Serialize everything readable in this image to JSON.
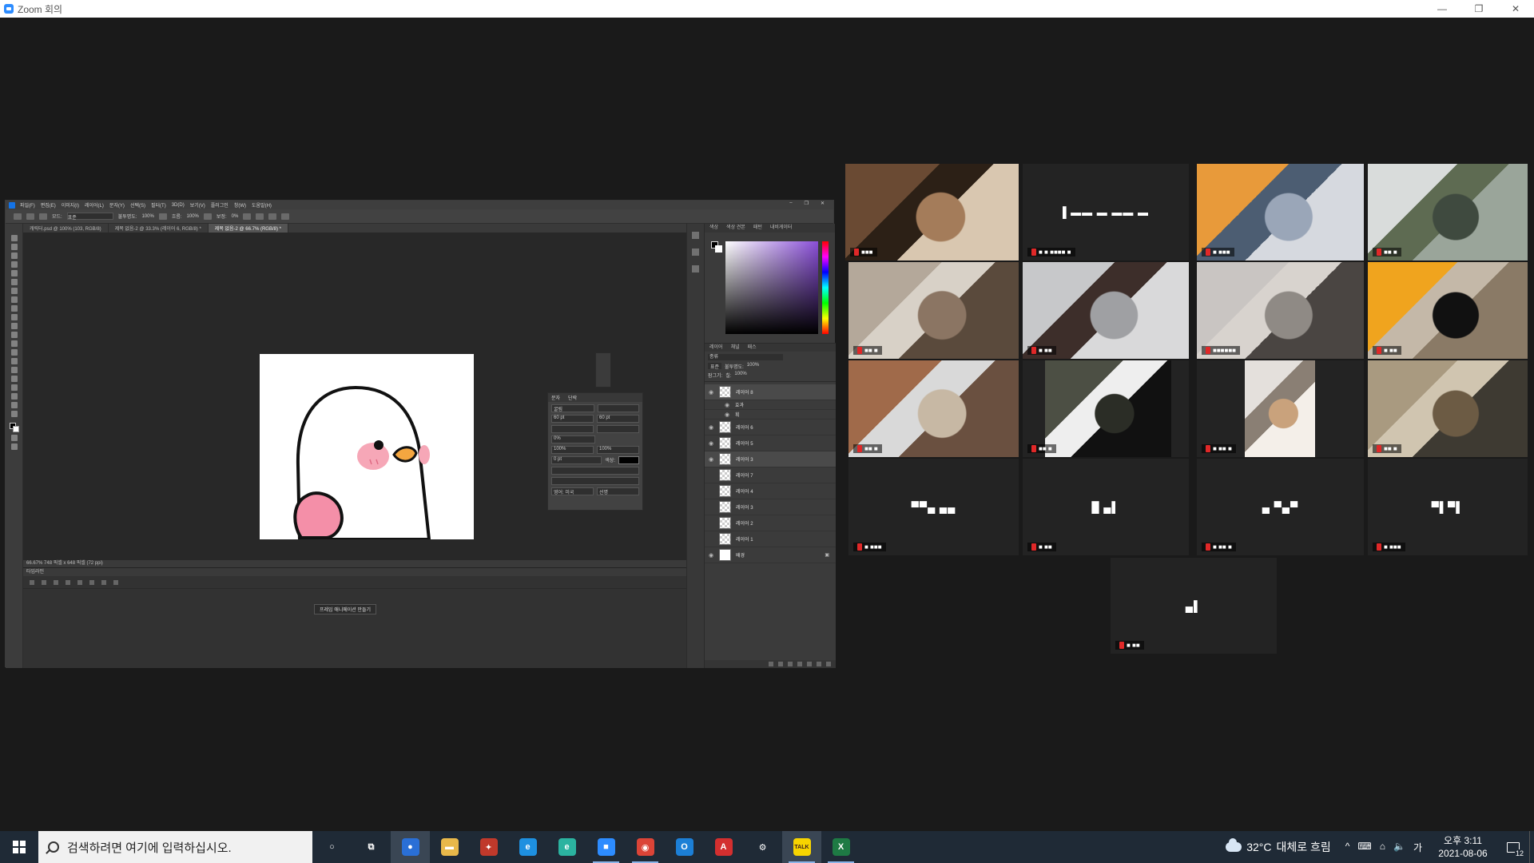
{
  "window": {
    "title": "Zoom 회의",
    "minimize": "—",
    "restore": "❐",
    "close": "✕"
  },
  "photoshop": {
    "menu": [
      "파일(F)",
      "편집(E)",
      "이미지(I)",
      "레이어(L)",
      "문자(Y)",
      "선택(S)",
      "필터(T)",
      "3D(D)",
      "보기(V)",
      "플러그인",
      "창(W)",
      "도움말(H)"
    ],
    "options": {
      "mode_label": "모드:",
      "mode_value": "표준",
      "opacity_label": "불투명도:",
      "opacity_value": "100%",
      "flow_label": "흐름:",
      "flow_value": "100%",
      "smooth_label": "보정:",
      "smooth_value": "0%"
    },
    "tabs": [
      "캐릭터.psd @ 100% (103, RGB/8)",
      "제목 없음-2 @ 33.3% (레이어 6, RGB/8) *",
      "제목 없음-2 @ 66.7% (RGB/8) *"
    ],
    "status": "66.67%    748 픽셀 x 648 픽셀 (72 ppi)",
    "char_panel": {
      "tab1": "문자",
      "tab2": "단락",
      "font": "굴림",
      "size": "60 pt",
      "leading": "60 pt",
      "scale_v": "100%",
      "scale_h": "100%",
      "tracking": "0%",
      "baseline": "0 pt",
      "color_label": "색상:",
      "lang": "영어: 미국",
      "aa": "선명"
    },
    "timeline": {
      "title": "타임라인",
      "button": "프레임 애니메이션 만들기"
    },
    "right": {
      "color_tabs": [
        "색상",
        "색상 견본",
        "패턴",
        "내비게이터"
      ],
      "layer_tabs": [
        "레이어",
        "채널",
        "패스"
      ],
      "kind_label": "종류",
      "blend": "표준",
      "opacity_label": "불투명도:",
      "opacity": "100%",
      "lock_label": "잠그기:",
      "fill_label": "칠:",
      "fill": "100%",
      "layers": [
        {
          "name": "레이어 8",
          "visible": true,
          "selected": true
        },
        {
          "name": "효과",
          "visible": true,
          "sub": true
        },
        {
          "name": "획",
          "visible": true,
          "sub": true
        },
        {
          "name": "레이어 6",
          "visible": true
        },
        {
          "name": "레이어 5",
          "visible": true
        },
        {
          "name": "레이어 3",
          "visible": true
        },
        {
          "name": "레이어 7",
          "visible": false
        },
        {
          "name": "레이어 4",
          "visible": false
        },
        {
          "name": "레이어 3",
          "visible": false
        },
        {
          "name": "레이어 2",
          "visible": false
        },
        {
          "name": "레이어 1",
          "visible": false
        },
        {
          "name": "배경",
          "visible": true,
          "background": true
        }
      ]
    }
  },
  "gallery": [
    {
      "id": "p1",
      "active": true,
      "kind": "video",
      "colors": [
        "#6a4a33",
        "#a47c5a",
        "#2c2016",
        "#d9c7b0"
      ],
      "name_tag": "■■■"
    },
    {
      "id": "p2",
      "kind": "name",
      "label": "▌▬▬ ▬ ▬▬ ▬",
      "name_tag": "■ ■ ■■■■ ■"
    },
    {
      "id": "p3",
      "kind": "video",
      "colors": [
        "#e89a3a",
        "#9aa6b8",
        "#4c5d72",
        "#d6d9df"
      ],
      "name_tag": "■ ■■■"
    },
    {
      "id": "p4",
      "kind": "video",
      "colors": [
        "#d9dcdb",
        "#3f4a3f",
        "#5e6b52",
        "#9aa59a"
      ],
      "name_tag": "■■ ■"
    },
    {
      "id": "p5",
      "kind": "video",
      "colors": [
        "#b4a89a",
        "#8b7563",
        "#d8d1c7",
        "#5a4a3c"
      ],
      "name_tag": "■■ ■"
    },
    {
      "id": "p6",
      "kind": "video",
      "colors": [
        "#c7c8ca",
        "#9fa0a3",
        "#3d2e2a",
        "#d9d9da"
      ],
      "name_tag": "■ ■■"
    },
    {
      "id": "p7",
      "kind": "video",
      "colors": [
        "#c9c5c2",
        "#8f8a85",
        "#d8d3ce",
        "#4a4542"
      ],
      "name_tag": "■■■■■■"
    },
    {
      "id": "p8",
      "kind": "video",
      "colors": [
        "#f0a41e",
        "#111111",
        "#c4b8a8",
        "#8a7a66"
      ],
      "name_tag": "■ ■■"
    },
    {
      "id": "p9",
      "kind": "video",
      "colors": [
        "#a06a4a",
        "#c7b8a4",
        "#d9d9d9",
        "#6a5040"
      ],
      "name_tag": "■■ ■"
    },
    {
      "id": "p10",
      "kind": "video",
      "colors": [
        "#4c4f44",
        "#2b2d26",
        "#eeeeee",
        "#111111"
      ],
      "name_tag": "■■ ■"
    },
    {
      "id": "p11",
      "kind": "video",
      "colors": [
        "#e4e0dc",
        "#c9a27c",
        "#8a7f74",
        "#f4efe9"
      ],
      "name_tag": "■ ■■ ■"
    },
    {
      "id": "p12",
      "kind": "video",
      "colors": [
        "#a99a80",
        "#6c5b44",
        "#d0c5b0",
        "#3e3a32"
      ],
      "name_tag": "■■ ■"
    },
    {
      "id": "p13",
      "kind": "name",
      "label": "▀▀▄ ▄▄",
      "name_tag": "■ ■■■"
    },
    {
      "id": "p14",
      "kind": "name",
      "label": "█ ▄▌",
      "name_tag": "■ ■■"
    },
    {
      "id": "p15",
      "kind": "name",
      "label": "▄ ▀▄▀",
      "name_tag": "■ ■■ ■"
    },
    {
      "id": "p16",
      "kind": "name",
      "label": "▀▌▀▌",
      "name_tag": "■ ■■■"
    },
    {
      "id": "p17",
      "kind": "name",
      "label": "▄▌",
      "name_tag": "■ ■■"
    }
  ],
  "taskbar": {
    "search_placeholder": "검색하려면 여기에 입력하십시오.",
    "apps": [
      {
        "name": "cortana-icon",
        "glyph": "○",
        "color": "transparent"
      },
      {
        "name": "task-view-icon",
        "glyph": "⧉",
        "color": "transparent"
      },
      {
        "name": "chrome-app-icon",
        "glyph": "●",
        "color": "#2a6fd6",
        "hl": true
      },
      {
        "name": "file-explorer-icon",
        "glyph": "▬",
        "color": "#e8b84a"
      },
      {
        "name": "photoshop-pinned-icon",
        "glyph": "✦",
        "color": "#c0392b"
      },
      {
        "name": "internet-explorer-icon",
        "glyph": "e",
        "color": "#1e90e0"
      },
      {
        "name": "edge-icon",
        "glyph": "e",
        "color": "#2bb3a0"
      },
      {
        "name": "zoom-app-icon",
        "glyph": "■",
        "color": "#2d8cff",
        "running": true
      },
      {
        "name": "chrome-icon",
        "glyph": "◉",
        "color": "#db4437",
        "running": true
      },
      {
        "name": "outlook-icon",
        "glyph": "O",
        "color": "#1c7fd6"
      },
      {
        "name": "acrobat-icon",
        "glyph": "A",
        "color": "#d32f2f"
      },
      {
        "name": "settings-app-icon",
        "glyph": "⚙",
        "color": "transparent"
      },
      {
        "name": "kakaotalk-icon",
        "glyph": "TALK",
        "color": "#f7d400",
        "hl": true,
        "running": true
      },
      {
        "name": "excel-icon",
        "glyph": "X",
        "color": "#1e7a44",
        "running": true
      }
    ],
    "weather": {
      "temp": "32°C",
      "desc": "대체로 흐림"
    },
    "tray_icons": [
      "^",
      "⌨",
      "⌂",
      "🔈",
      "가"
    ],
    "time": "오후 3:11",
    "date": "2021-08-06",
    "notifications": "12"
  }
}
